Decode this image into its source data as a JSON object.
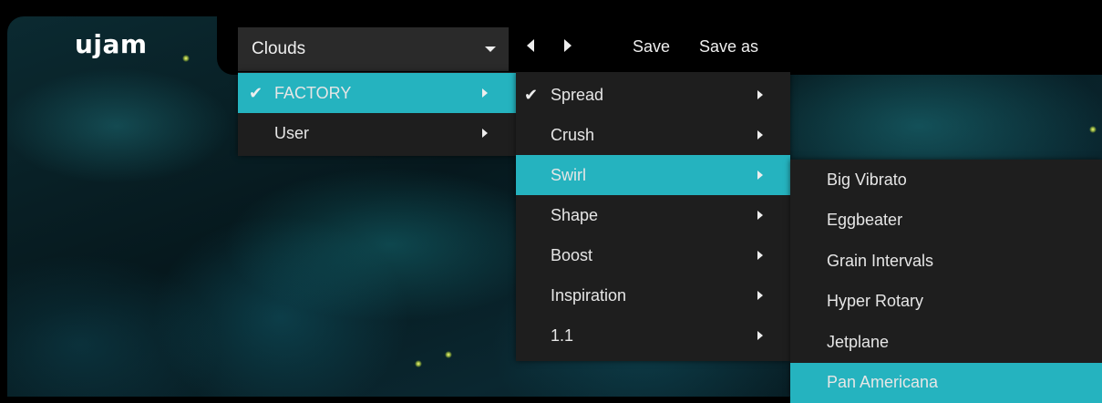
{
  "app": {
    "logo": "ujam"
  },
  "toolbar": {
    "preset_value": "Clouds",
    "save_label": "Save",
    "save_as_label": "Save as"
  },
  "menu_level1": {
    "items": [
      {
        "label": "FACTORY",
        "checked": true,
        "has_submenu": true,
        "active": true
      },
      {
        "label": "User",
        "checked": false,
        "has_submenu": true,
        "active": false
      }
    ]
  },
  "menu_level2": {
    "items": [
      {
        "label": "Spread",
        "checked": true,
        "has_submenu": true,
        "active": false
      },
      {
        "label": "Crush",
        "checked": false,
        "has_submenu": true,
        "active": false
      },
      {
        "label": "Swirl",
        "checked": false,
        "has_submenu": true,
        "active": true
      },
      {
        "label": "Shape",
        "checked": false,
        "has_submenu": true,
        "active": false
      },
      {
        "label": "Boost",
        "checked": false,
        "has_submenu": true,
        "active": false
      },
      {
        "label": "Inspiration",
        "checked": false,
        "has_submenu": true,
        "active": false
      },
      {
        "label": "1.1",
        "checked": false,
        "has_submenu": true,
        "active": false
      }
    ]
  },
  "menu_level3": {
    "items": [
      {
        "label": "Big Vibrato",
        "active": false
      },
      {
        "label": "Eggbeater",
        "active": false
      },
      {
        "label": "Grain Intervals",
        "active": false
      },
      {
        "label": "Hyper Rotary",
        "active": false
      },
      {
        "label": "Jetplane",
        "active": false
      },
      {
        "label": "Pan Americana",
        "active": true
      }
    ]
  },
  "colors": {
    "accent": "#25b3bf",
    "menu_bg": "#1e1e1e",
    "dropdown_bg": "#2a2a2a"
  }
}
